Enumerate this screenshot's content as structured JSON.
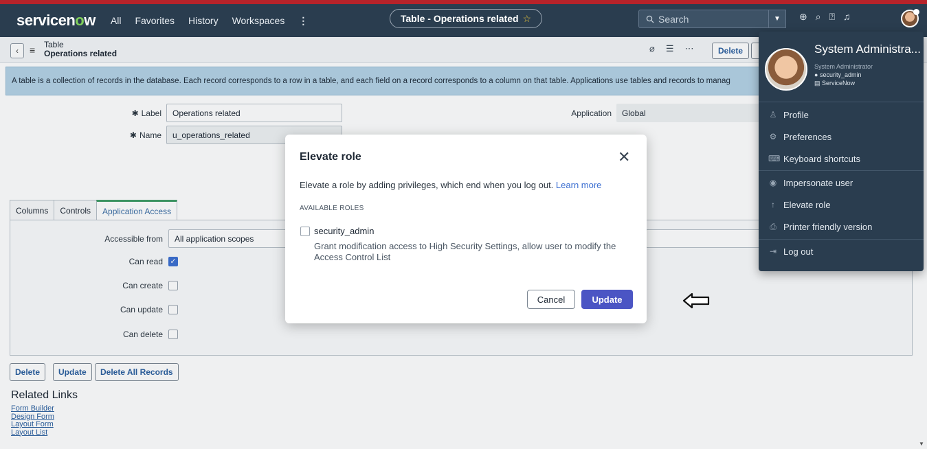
{
  "nav": {
    "logo_text": "servicen",
    "logo_o": "o",
    "logo_end": "w",
    "links": [
      "All",
      "Favorites",
      "History",
      "Workspaces"
    ],
    "more": "⋮",
    "tab_title": "Table - Operations related",
    "tab_star": "☆",
    "search_placeholder": "Search"
  },
  "form_header": {
    "line1": "Table",
    "line2": "Operations related",
    "delete_button": "Delete"
  },
  "info_text": "A table is a collection of records in the database. Each record corresponds to a row in a table, and each field on a record corresponds to a column on that table. Applications use tables and records to manag",
  "fields": {
    "label_label": "Label",
    "label_value": "Operations related",
    "name_label": "Name",
    "name_value": "u_operations_related",
    "application_label": "Application",
    "application_value": "Global",
    "required_mark": "✱"
  },
  "tabs": [
    "Columns",
    "Controls",
    "Application Access"
  ],
  "access": {
    "accessible_from_label": "Accessible from",
    "accessible_from_value": "All application scopes",
    "can_read": "Can read",
    "can_create": "Can create",
    "can_update": "Can update",
    "can_delete": "Can delete",
    "can_read_checked": true
  },
  "bottom_buttons": [
    "Delete",
    "Update",
    "Delete All Records"
  ],
  "related": {
    "title": "Related Links",
    "links": [
      "Form Builder",
      "Design Form",
      "Layout Form",
      "Layout List"
    ]
  },
  "modal": {
    "title": "Elevate role",
    "text": "Elevate a role by adding privileges, which end when you log out.",
    "learn_more": "Learn more",
    "section": "AVAILABLE ROLES",
    "role_name": "security_admin",
    "role_desc": "Grant modification access to High Security Settings, allow user to modify the Access Control List",
    "cancel": "Cancel",
    "update": "Update"
  },
  "user_menu": {
    "name": "System Administra...",
    "role": "System Administrator",
    "elevated": "security_admin",
    "instance": "ServiceNow",
    "items": [
      {
        "icon": "person-icon",
        "label": "Profile"
      },
      {
        "icon": "gear-icon",
        "label": "Preferences"
      },
      {
        "icon": "keyboard-icon",
        "label": "Keyboard shortcuts"
      },
      {
        "icon": "eye-icon",
        "label": "Impersonate user"
      },
      {
        "icon": "arrow-up-icon",
        "label": "Elevate role"
      },
      {
        "icon": "printer-icon",
        "label": "Printer friendly version"
      },
      {
        "icon": "logout-icon",
        "label": "Log out"
      }
    ]
  },
  "colors": {
    "nav_bg": "#2a3d4f",
    "accent_red": "#b7232a",
    "primary_button": "#4b55c4",
    "info_bar": "#b4d2e6"
  }
}
